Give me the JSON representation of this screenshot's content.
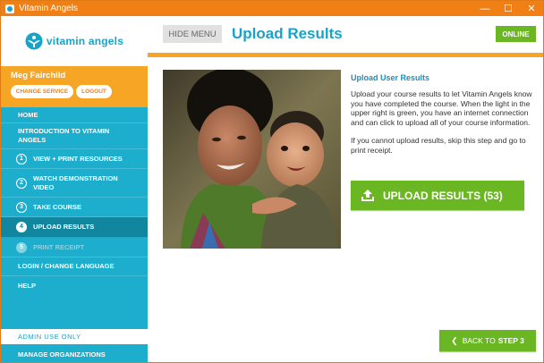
{
  "window": {
    "title": "Vitamin Angels",
    "controls": [
      "—",
      "☐",
      "✕"
    ]
  },
  "sidebar": {
    "logo_text": "vitamin angels",
    "user_name": "Meg Fairchild",
    "change_service_label": "CHANGE SERVICE",
    "logout_label": "LOGOUT",
    "items": [
      {
        "label": "HOME",
        "number": "",
        "state": "normal"
      },
      {
        "label": "INTRODUCTION TO VITAMIN ANGELS",
        "number": "",
        "state": "normal"
      },
      {
        "label": "VIEW + PRINT RESOURCES",
        "number": "1",
        "state": "normal"
      },
      {
        "label": "WATCH DEMONSTRATION VIDEO",
        "number": "2",
        "state": "normal"
      },
      {
        "label": "TAKE COURSE",
        "number": "3",
        "state": "normal"
      },
      {
        "label": "UPLOAD RESULTS",
        "number": "4",
        "state": "active"
      },
      {
        "label": "PRINT RECEIPT",
        "number": "5",
        "state": "disabled"
      },
      {
        "label": "LOGIN / CHANGE LANGUAGE",
        "number": "",
        "state": "normal"
      },
      {
        "label": "HELP",
        "number": "",
        "state": "normal"
      }
    ],
    "admin_label": "ADMIN USE ONLY",
    "manage_label": "MANAGE ORGANIZATIONS"
  },
  "header": {
    "hide_menu_label": "HIDE MENU",
    "page_title": "Upload Results",
    "status_label": "ONLINE"
  },
  "main": {
    "section_title": "Upload User Results",
    "paragraph_1": "Upload your course results to let Vitamin Angels know you have completed the course. When the light in the upper right is green, you have an internet connection and can click to upload all of your course information.",
    "paragraph_2": "If you cannot upload results, skip this step and go to print receipt.",
    "upload_button_label": "UPLOAD RESULTS (53)",
    "back_button_prefix": "BACK TO",
    "back_button_step": "STEP 3"
  },
  "colors": {
    "brand_teal": "#1eaecd",
    "brand_orange": "#f7a524",
    "titlebar_orange": "#f07f16",
    "action_green": "#6ab723"
  },
  "icons": [
    "app-icon",
    "vitamin-angels-logo-icon",
    "upload-icon",
    "chevron-left-icon"
  ]
}
